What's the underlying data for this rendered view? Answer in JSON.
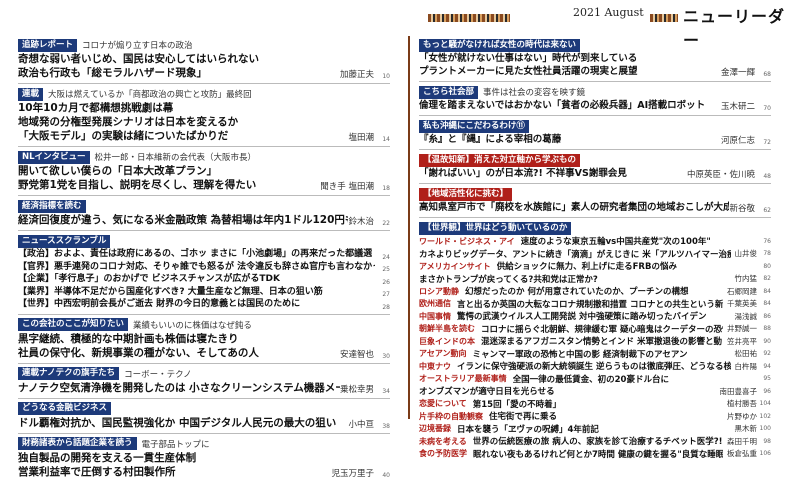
{
  "header": {
    "date": "2021 August",
    "title": "ニューリーダー"
  },
  "left": [
    {
      "tag": "追跡レポート",
      "tag_sub": "コロナが煽り立す日本の政治",
      "lines": [
        "奇想な弱い者いじめ、国民は安心してはいられない",
        "政治も行政も「総モラルハザード現象」"
      ],
      "author": "加藤正夫",
      "page": "10"
    },
    {
      "tag": "連載",
      "tag_sub": "大阪は燃えているか「商都政治の興亡と攻防」最終回",
      "lines": [
        "10年10カ月で都構想挑戦劇は幕",
        "地域発の分権型発展シナリオは日本を変えるか",
        "「大阪モデル」の実験は緒についたばかりだ"
      ],
      "author": "塩田潮",
      "page": "14"
    },
    {
      "tag": "NLインタビュー",
      "tag_sub": "松井一郎・日本維新の会代表（大阪市長）",
      "lines": [
        "開いて欲しい僕らの「日本大改革プラン」",
        "野党第1党を目指し、説明を尽くし、理解を得たい"
      ],
      "author": "聞き手 塩田潮",
      "page": "18"
    },
    {
      "tag": "経済指標を読む",
      "tag_sub": "",
      "lines": [
        "経済回復度が違う、気になる米金融政策 為替相場は年内1ドル120円も"
      ],
      "author": "鈴木治",
      "page": "22"
    },
    {
      "tag": "ニューススクランブル",
      "tag_sub": "",
      "small": [
        {
          "label": "【政治】",
          "text": "およよ、責任は政府にあるの、ゴホッ まさに「小池劇場」の再来だった都議選",
          "page": "24"
        },
        {
          "label": "【官界】",
          "text": "悪手連発のコロナ対応、そりゃ誰でも怒るが 法令違反も辞さぬ官庁も言わなかった?",
          "page": "25"
        },
        {
          "label": "【企業】",
          "text": "「孝行息子」のおかげで ビジネスチャンスが広がるTDK",
          "page": "26"
        },
        {
          "label": "【業界】",
          "text": "半導体不足だから国産化すべき? 大量生産など無理、日本の狙い筋",
          "page": "27"
        },
        {
          "label": "【世界】",
          "text": "中西宏明前会長がご逝去 財界の今日的意義とは国民のために",
          "page": "28"
        }
      ]
    },
    {
      "tag": "この会社のここが知りたい",
      "tag_sub": "業績もいいのに株価はなぜ鈍る",
      "lines": [
        "黒字継続、積極的な中期計画も株価は寝たきり",
        "社員の保守化、新規事業の種がない、そしてあの人"
      ],
      "author": "安達智也",
      "page": "30"
    },
    {
      "tag": "連載ナノテクの旗手たち",
      "tag_sub": "コーボー・テクノ",
      "lines": [
        "ナノテク空気清浄機を開発したのは 小さなクリーンシステム機器メーカー"
      ],
      "author": "乗松幸男",
      "page": "34"
    },
    {
      "tag": "どうなる金融ビジネス",
      "tag_sub": "",
      "lines": [
        "ドル覇権対抗か、国民監視強化か 中国デジタル人民元の最大の狙い"
      ],
      "author": "小中亘",
      "page": "38"
    },
    {
      "tag": "財務諸表から話題企業を読う",
      "tag_sub": "電子部品トップに",
      "lines": [
        "独自製品の開発を支える一貫生産体制",
        "営業利益率で圧倒する村田製作所"
      ],
      "author": "児玉万里子",
      "page": "40"
    }
  ],
  "right_top": [
    {
      "tag": "もっと騒がなければ女性の時代は来ない",
      "lines": [
        "「女性が就けない仕事はない」時代が到来している",
        "プラントメーカーに見た女性社員活躍の現実と展望"
      ],
      "author": "金澤一輝",
      "page": "68"
    },
    {
      "tag": "こちら社会部",
      "tag_sub": "事件は社会の変容を映す鏡",
      "lines": [
        "倫理を踏まえないではおかない「貧者の必殺兵器」AI搭載ロボット"
      ],
      "author": "玉木研二",
      "page": "70"
    },
    {
      "tag": "私も沖縄にこだわるわけ⑪",
      "lines": [
        "『糸』と『縄』による宰相の葛藤"
      ],
      "author": "河原仁志",
      "page": "72"
    },
    {
      "tag": "【温故知新】消えた対立軸から学ぶもの",
      "red": true,
      "lines": [
        "「謝ればいい」のが日本流?! 不祥事VS謝罪会見"
      ],
      "author": "中原英臣・佐川暁",
      "page": "48"
    },
    {
      "tag": "【地域活性化に挑む】",
      "red": true,
      "lines": [
        "高知県室戸市で「廃校を水族館に」素人の研究者集団の地域おこしが大成功!"
      ],
      "author": "新谷敬",
      "page": "62"
    }
  ],
  "right_list_header": "【世界観】世界はどう動いているのか",
  "right_list": [
    {
      "label": "ワールド・ビジネス・アイ",
      "text": "速度のような東京五輪vs中国共産党\"次の100年\"",
      "author": "",
      "page": "76"
    },
    {
      "label": "",
      "text": "カネよりビッグデータ、アントに続き「滴滴」がえじきに 米「アルツハイマー治療薬」承認の不透明プロセス",
      "author": "山井俊",
      "page": "78"
    },
    {
      "label": "アメリカインサイト",
      "text": "供給ショックに無力、利上げに走るFRBの悩み",
      "author": "",
      "page": "80"
    },
    {
      "label": "",
      "text": "まさかトランプが戻ってくる?共和党は正常か?",
      "author": "竹内猛",
      "page": "82"
    },
    {
      "label": "ロシア動静",
      "text": "幻想だったのか 何が用意されていたのか、プーチンの構想",
      "author": "石郷岡建",
      "page": "84"
    },
    {
      "label": "欧州通信",
      "text": "言と出るか英国の大転なコロナ規制撤和措置 コロナとの共生という新国際での独仏選挙の行方",
      "author": "千葉英美",
      "page": "84"
    },
    {
      "label": "中国事情",
      "text": "驚愕の武漢ウイルス人工開発説 対中強硬策に踏み切ったバイデン",
      "author": "湯浅誠",
      "page": "86"
    },
    {
      "label": "朝鮮半島を読む",
      "text": "コロナに揺らぐ北朝鮮、規律緩む軍 疑心暗鬼はクーデターの恐怖へ",
      "author": "井野誠一",
      "page": "88"
    },
    {
      "label": "巨象インドの本",
      "text": "混迷深まるアフガニスタン情勢とインド 米軍撤退後の影響と動きを読む",
      "author": "笠井亮平",
      "page": "90"
    },
    {
      "label": "アセアン動向",
      "text": "ミャンマー軍政の恐怖と中国の影 経済制裁下のアセアン",
      "author": "松田祐",
      "page": "92"
    },
    {
      "label": "中東ナウ",
      "text": "イランに保守強硬派の新大統領誕生 逆らうものは徹底弾圧、どうなる核合意",
      "author": "白杵陽",
      "page": "94"
    },
    {
      "label": "オーストラリア最新事情",
      "text": "全国一律の最低賃金、初の20豪ドル台に",
      "author": "",
      "page": "95"
    },
    {
      "label": "",
      "text": "オンブズマンが適守日目を光らせる",
      "author": "南田豊喜子",
      "page": "96"
    },
    {
      "label": "恋愛について",
      "text": "第15回「愛の不時着」",
      "author": "植村勝吾",
      "page": "104"
    },
    {
      "label": "片手枠の自動観察",
      "text": "住宅街で再に乗る",
      "author": "片野ゆか",
      "page": "102"
    },
    {
      "label": "辺境番録",
      "text": "日本を襲う「ヱヴァの呪縛」4年前記",
      "author": "黒木新",
      "page": "100"
    },
    {
      "label": "未病を考える",
      "text": "世界の伝統医療の旅 病人の、家族を診て治療するチベット医学?!",
      "author": "森田千明",
      "page": "98"
    },
    {
      "label": "食の予防医学",
      "text": "眠れない夜もあるけれど何とか7時間 健康の鍵を握る\"良質な睡眠\"",
      "author": "板倉弘重",
      "page": "106"
    }
  ]
}
